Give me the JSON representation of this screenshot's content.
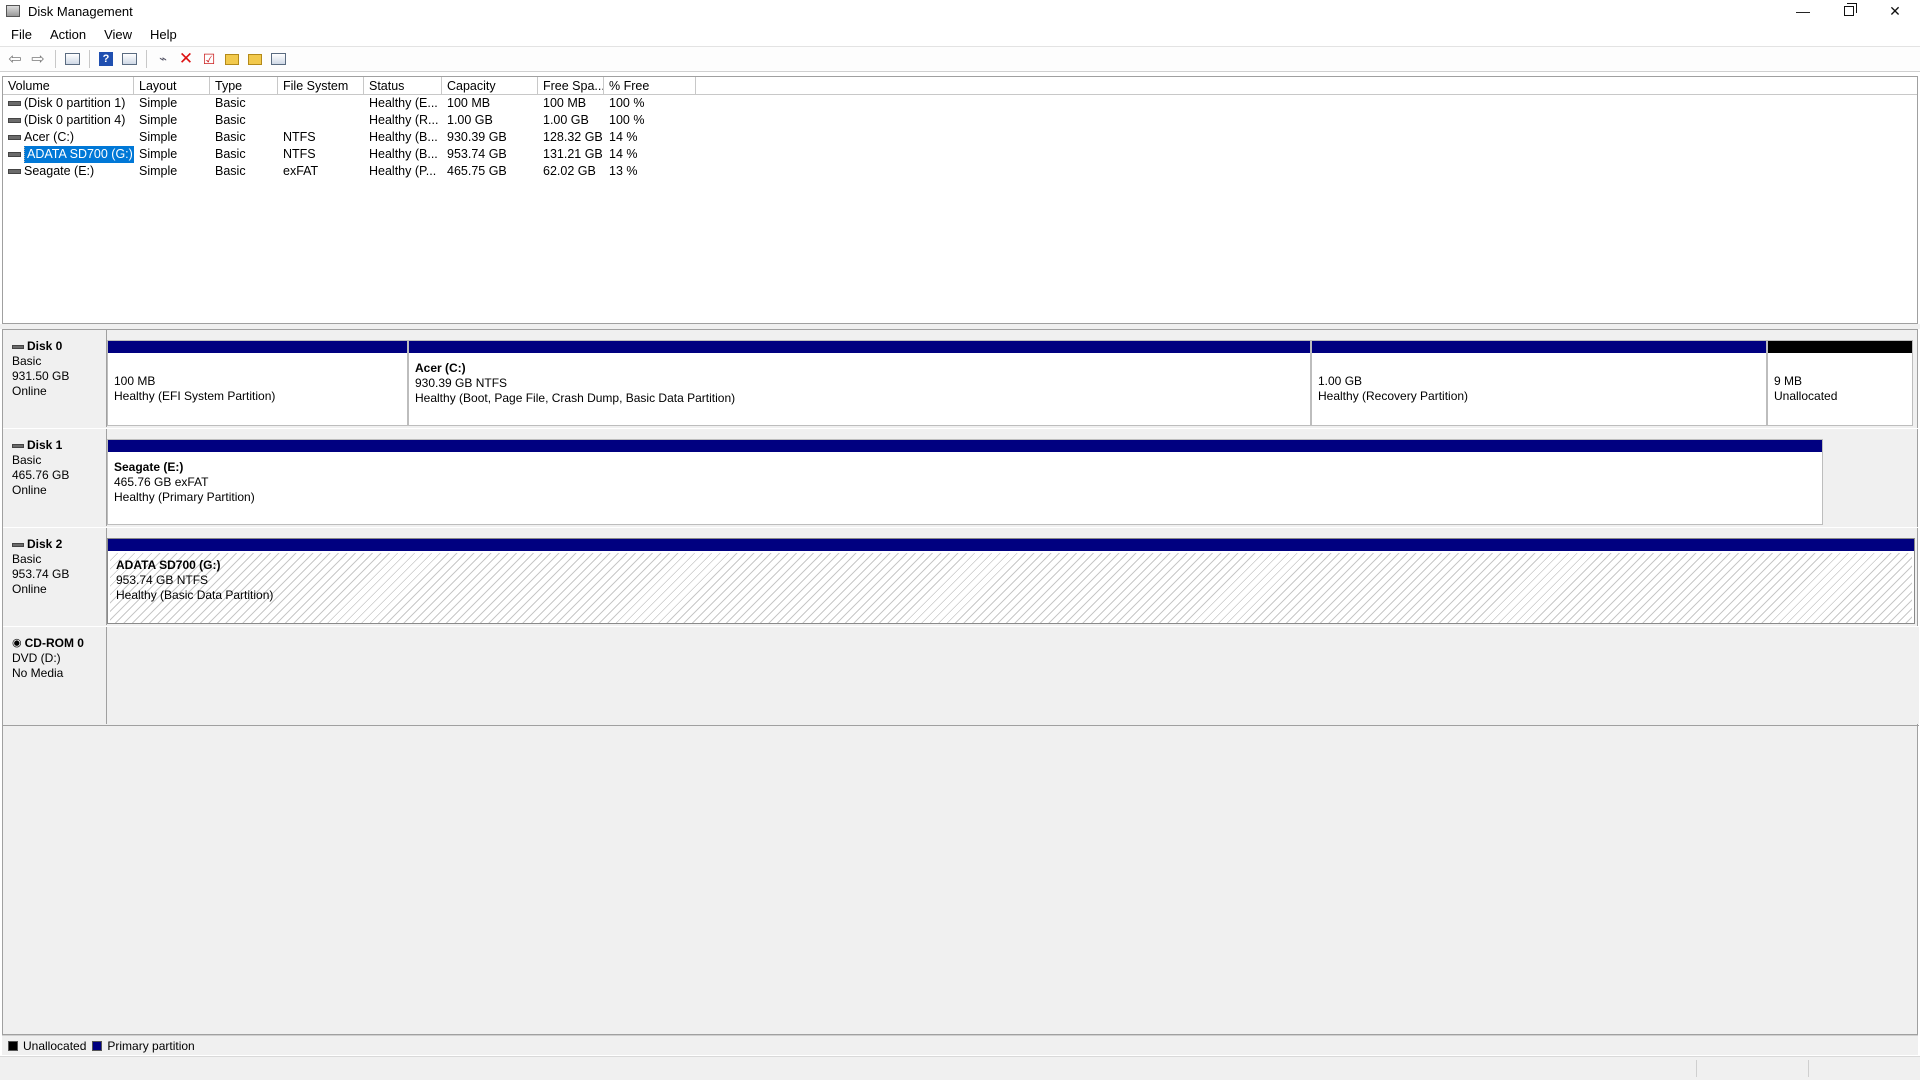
{
  "window": {
    "title": "Disk Management",
    "minimize_glyph": "—",
    "close_glyph": "✕"
  },
  "menu": [
    "File",
    "Action",
    "View",
    "Help"
  ],
  "toolbar": {
    "icons": [
      "back-icon",
      "forward-icon",
      "properties-icon",
      "help-icon",
      "console-view-icon",
      "connect-icon",
      "delete-icon",
      "check-icon",
      "folder-up-icon",
      "folder-search-icon",
      "settings-icon"
    ]
  },
  "volume_list": {
    "columns": [
      "Volume",
      "Layout",
      "Type",
      "File System",
      "Status",
      "Capacity",
      "Free Spa...",
      "% Free"
    ],
    "rows": [
      {
        "volume": "(Disk 0 partition 1)",
        "layout": "Simple",
        "type": "Basic",
        "fs": "",
        "status": "Healthy (E...",
        "capacity": "100 MB",
        "free": "100 MB",
        "pct": "100 %"
      },
      {
        "volume": "(Disk 0 partition 4)",
        "layout": "Simple",
        "type": "Basic",
        "fs": "",
        "status": "Healthy (R...",
        "capacity": "1.00 GB",
        "free": "1.00 GB",
        "pct": "100 %"
      },
      {
        "volume": "Acer (C:)",
        "layout": "Simple",
        "type": "Basic",
        "fs": "NTFS",
        "status": "Healthy (B...",
        "capacity": "930.39 GB",
        "free": "128.32 GB",
        "pct": "14 %"
      },
      {
        "volume": "ADATA SD700 (G:)",
        "layout": "Simple",
        "type": "Basic",
        "fs": "NTFS",
        "status": "Healthy (B...",
        "capacity": "953.74 GB",
        "free": "131.21 GB",
        "pct": "14 %"
      },
      {
        "volume": "Seagate (E:)",
        "layout": "Simple",
        "type": "Basic",
        "fs": "exFAT",
        "status": "Healthy (P...",
        "capacity": "465.75 GB",
        "free": "62.02 GB",
        "pct": "13 %"
      }
    ]
  },
  "disks": [
    {
      "name": "Disk 0",
      "kind": "Basic",
      "size": "931.50 GB",
      "state": "Online",
      "partitions": [
        {
          "name": "",
          "size": "100 MB",
          "status": "Healthy (EFI System Partition)"
        },
        {
          "name": "Acer  (C:)",
          "size": "930.39 GB NTFS",
          "status": "Healthy (Boot, Page File, Crash Dump, Basic Data Partition)"
        },
        {
          "name": "",
          "size": "1.00 GB",
          "status": "Healthy (Recovery Partition)"
        },
        {
          "name": "",
          "size": "9 MB",
          "status": "Unallocated"
        }
      ]
    },
    {
      "name": "Disk 1",
      "kind": "Basic",
      "size": "465.76 GB",
      "state": "Online",
      "partitions": [
        {
          "name": "Seagate  (E:)",
          "size": "465.76 GB exFAT",
          "status": "Healthy (Primary Partition)"
        }
      ]
    },
    {
      "name": "Disk 2",
      "kind": "Basic",
      "size": "953.74 GB",
      "state": "Online",
      "partitions": [
        {
          "name": "ADATA SD700  (G:)",
          "size": "953.74 GB NTFS",
          "status": "Healthy (Basic Data Partition)"
        }
      ]
    },
    {
      "name": "CD-ROM 0",
      "kind": "DVD (D:)",
      "size": "",
      "state": "No Media",
      "partitions": []
    }
  ],
  "legend": [
    {
      "label": "Unallocated",
      "color": "#000000"
    },
    {
      "label": "Primary partition",
      "color": "#000080"
    }
  ]
}
